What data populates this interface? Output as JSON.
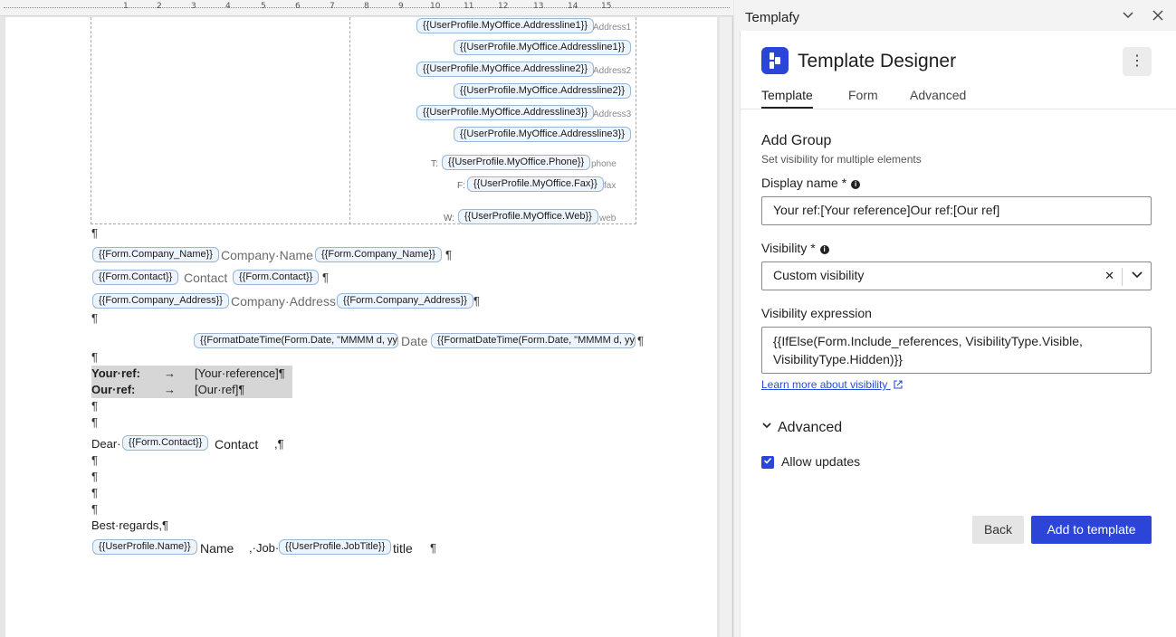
{
  "document": {
    "ruler_numbers": [
      "1",
      "2",
      "3",
      "4",
      "5",
      "6",
      "7",
      "8",
      "9",
      "10",
      "11",
      "12",
      "13",
      "14",
      "15"
    ],
    "address_block": {
      "line1_tag": "{{UserProfile.MyOffice.Addressline1}}",
      "line1_hint": "Address1",
      "line1_value": "{{UserProfile.MyOffice.Addressline1}}",
      "line2_tag": "{{UserProfile.MyOffice.Addressline2}}",
      "line2_hint": "Address2",
      "line2_value": "{{UserProfile.MyOffice.Addressline2}}",
      "line3_tag": "{{UserProfile.MyOffice.Addressline3}}",
      "line3_hint": "Address3",
      "line3_value": "{{UserProfile.MyOffice.Addressline3}}",
      "phone_label": "T:",
      "phone_tag": "{{UserProfile.MyOffice.Phone}}",
      "phone_hint": "phone",
      "fax_label": "F:",
      "fax_tag": "{{UserProfile.MyOffice.Fax}}",
      "fax_hint": "fax",
      "web_label": "W:",
      "web_tag": "{{UserProfile.MyOffice.Web}}",
      "web_hint": "web"
    },
    "company_tag": "{{Form.Company_Name}}",
    "company_text": "Company·Name",
    "contact_tag": "{{Form.Contact}}",
    "contact_text": "Contact",
    "address_tag": "{{Form.Company_Address}}",
    "address_text": "Company·Address",
    "date_tag": "{{FormatDateTime(Form.Date, \"MMMM d, yy",
    "date_text": "Date",
    "your_ref_label": "Your·ref:",
    "your_ref_value": "[Your·reference]¶",
    "our_ref_label": "Our·ref:",
    "our_ref_value": "[Our·ref]¶",
    "arrow": "→",
    "dear": "Dear·",
    "dear_contact": "Contact",
    "dear_end": ",¶",
    "best_regards": "Best·regards,¶",
    "name_tag": "{{UserProfile.Name}}",
    "name_text": "Name",
    "job_sep": ",·Job·",
    "job_tag": "{{UserProfile.JobTitle}}",
    "job_text": "title",
    "pilcrow": "¶"
  },
  "panel": {
    "title": "Templafy",
    "app_title": "Template Designer",
    "tabs": [
      {
        "label": "Template",
        "active": true
      },
      {
        "label": "Form",
        "active": false
      },
      {
        "label": "Advanced",
        "active": false
      }
    ],
    "section_title": "Add Group",
    "section_subtitle": "Set visibility for multiple elements",
    "display_name_label": "Display name *",
    "display_name_value": "Your ref:[Your reference]Our ref:[Our ref]",
    "visibility_label": "Visibility *",
    "visibility_value": "Custom visibility",
    "expression_label": "Visibility expression",
    "expression_value": "{{IfElse(Form.Include_references, VisibilityType.Visible, VisibilityType.Hidden)}}",
    "learn_more": "Learn more about visibility",
    "advanced_title": "Advanced",
    "allow_updates_label": "Allow updates",
    "allow_updates_checked": true,
    "back_button": "Back",
    "add_button": "Add to template",
    "accent_color": "#2a45d8"
  }
}
